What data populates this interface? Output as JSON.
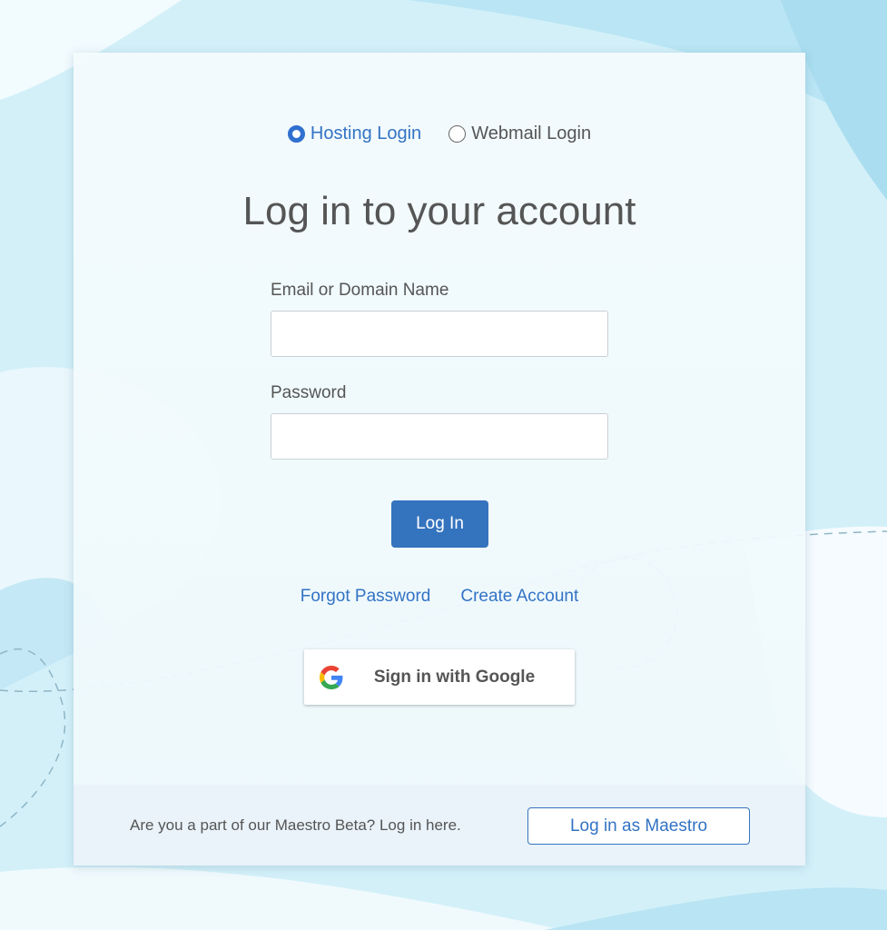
{
  "login_type": {
    "options": [
      {
        "label": "Hosting Login",
        "selected": true
      },
      {
        "label": "Webmail Login",
        "selected": false
      }
    ]
  },
  "form": {
    "title": "Log in to your account",
    "email_label": "Email or Domain Name",
    "email_value": "",
    "password_label": "Password",
    "password_value": "",
    "submit_label": "Log In"
  },
  "links": {
    "forgot_password": "Forgot Password",
    "create_account": "Create Account"
  },
  "google": {
    "label": "Sign in with Google",
    "icon": "google-g-icon"
  },
  "footer": {
    "text": "Are you a part of our Maestro Beta? Log in here.",
    "button_label": "Log in as Maestro"
  },
  "colors": {
    "accent": "#3473be",
    "link": "#3373c4",
    "text": "#555555",
    "background": "#cdeef8"
  }
}
